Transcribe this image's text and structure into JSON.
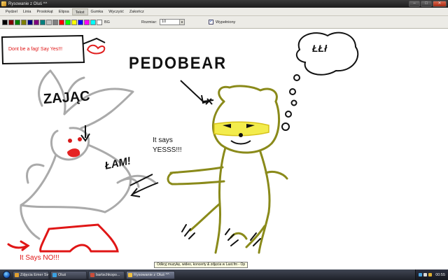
{
  "window": {
    "title": "Rysowanie z Oluś ^^",
    "buttons": [
      "–",
      "□",
      "✕"
    ]
  },
  "menu": {
    "items": [
      {
        "label": "Pędzel"
      },
      {
        "label": "Linia"
      },
      {
        "label": "Prostokąt"
      },
      {
        "label": "Elipsa"
      },
      {
        "label": "Tekst"
      },
      {
        "label": "Gumka"
      },
      {
        "label": "Wyczyść"
      },
      {
        "label": "Zakończ"
      }
    ],
    "active": "Tekst"
  },
  "palette": {
    "colors": [
      "#000000",
      "#7f0000",
      "#007f00",
      "#7f7f00",
      "#00007f",
      "#7f007f",
      "#007f7f",
      "#c0c0c0",
      "#808080",
      "#ff0000",
      "#00ff00",
      "#ffff00",
      "#0000ff",
      "#ff00ff",
      "#00ffff",
      "#ffffff"
    ],
    "bg_label": "BG",
    "size_label": "Rozmiar:",
    "size_value": "10",
    "fill_label": "Wypełniony",
    "fill_checked": true
  },
  "canvas": {
    "texts": {
      "box": "Dont be a fag! Say Yes!!!",
      "pedobear": "PEDOBEAR",
      "thought": "ŁŁł",
      "zajac": "ZAJĄC",
      "om": "ŁAM!",
      "says_line1": "It says",
      "says_line2": "YESSS!!!",
      "no": "It Says NO!!!"
    }
  },
  "tooltip": "Odkryj muzykę, wideo, koncerty & zdjęcia w Last.fm - Op",
  "taskbar": {
    "tasks": [
      {
        "label": "Zdjęcia Emer Swkah -...",
        "color": "#e0a030"
      },
      {
        "label": "Oluś",
        "color": "#3aa0e0"
      },
      {
        "label": "bartschkopo...",
        "color": "#c94d3a"
      },
      {
        "label": "Rysowanie z Oluś ^^",
        "color": "#f0c040"
      }
    ],
    "clock": "00:55"
  }
}
